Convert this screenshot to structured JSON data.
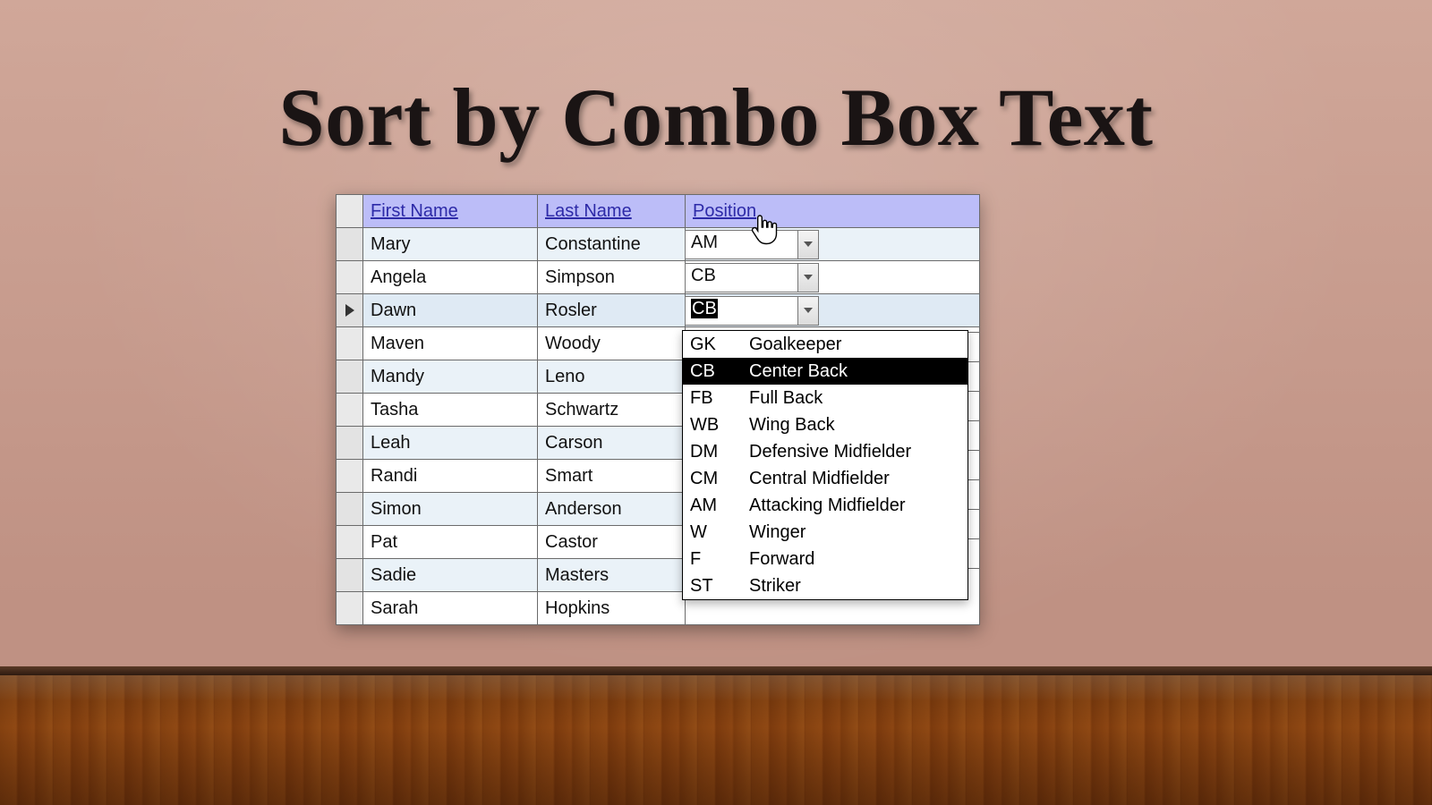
{
  "slide": {
    "title": "Sort by Combo Box Text"
  },
  "grid": {
    "headers": {
      "first": "First Name",
      "last": "Last Name",
      "position": "Position"
    },
    "rows": [
      {
        "first": "Mary",
        "last": "Constantine",
        "pos": "AM",
        "combo_visible": true,
        "active": false,
        "alt": true
      },
      {
        "first": "Angela",
        "last": "Simpson",
        "pos": "CB",
        "combo_visible": true,
        "active": false,
        "alt": false
      },
      {
        "first": "Dawn",
        "last": "Rosler",
        "pos": "CB",
        "combo_visible": true,
        "active": true,
        "alt": false,
        "selected_text": true
      },
      {
        "first": "Maven",
        "last": "Woody",
        "pos": "",
        "combo_visible": false,
        "active": false,
        "alt": false
      },
      {
        "first": "Mandy",
        "last": "Leno",
        "pos": "",
        "combo_visible": false,
        "active": false,
        "alt": true
      },
      {
        "first": "Tasha",
        "last": "Schwartz",
        "pos": "",
        "combo_visible": false,
        "active": false,
        "alt": false
      },
      {
        "first": "Leah",
        "last": "Carson",
        "pos": "",
        "combo_visible": false,
        "active": false,
        "alt": true
      },
      {
        "first": "Randi",
        "last": "Smart",
        "pos": "",
        "combo_visible": false,
        "active": false,
        "alt": false
      },
      {
        "first": "Simon",
        "last": "Anderson",
        "pos": "",
        "combo_visible": false,
        "active": false,
        "alt": true
      },
      {
        "first": "Pat",
        "last": "Castor",
        "pos": "",
        "combo_visible": false,
        "active": false,
        "alt": false
      },
      {
        "first": "Sadie",
        "last": "Masters",
        "pos": "",
        "combo_visible": false,
        "active": false,
        "alt": true
      },
      {
        "first": "Sarah",
        "last": "Hopkins",
        "pos": "",
        "combo_visible": false,
        "active": false,
        "alt": false
      }
    ]
  },
  "dropdown": {
    "selected_abbr": "CB",
    "options": [
      {
        "abbr": "GK",
        "name": "Goalkeeper"
      },
      {
        "abbr": "CB",
        "name": "Center Back"
      },
      {
        "abbr": "FB",
        "name": "Full Back"
      },
      {
        "abbr": "WB",
        "name": "Wing Back"
      },
      {
        "abbr": "DM",
        "name": "Defensive Midfielder"
      },
      {
        "abbr": "CM",
        "name": "Central Midfielder"
      },
      {
        "abbr": "AM",
        "name": "Attacking Midfielder"
      },
      {
        "abbr": "W",
        "name": "Winger"
      },
      {
        "abbr": "F",
        "name": "Forward"
      },
      {
        "abbr": "ST",
        "name": "Striker"
      }
    ]
  }
}
